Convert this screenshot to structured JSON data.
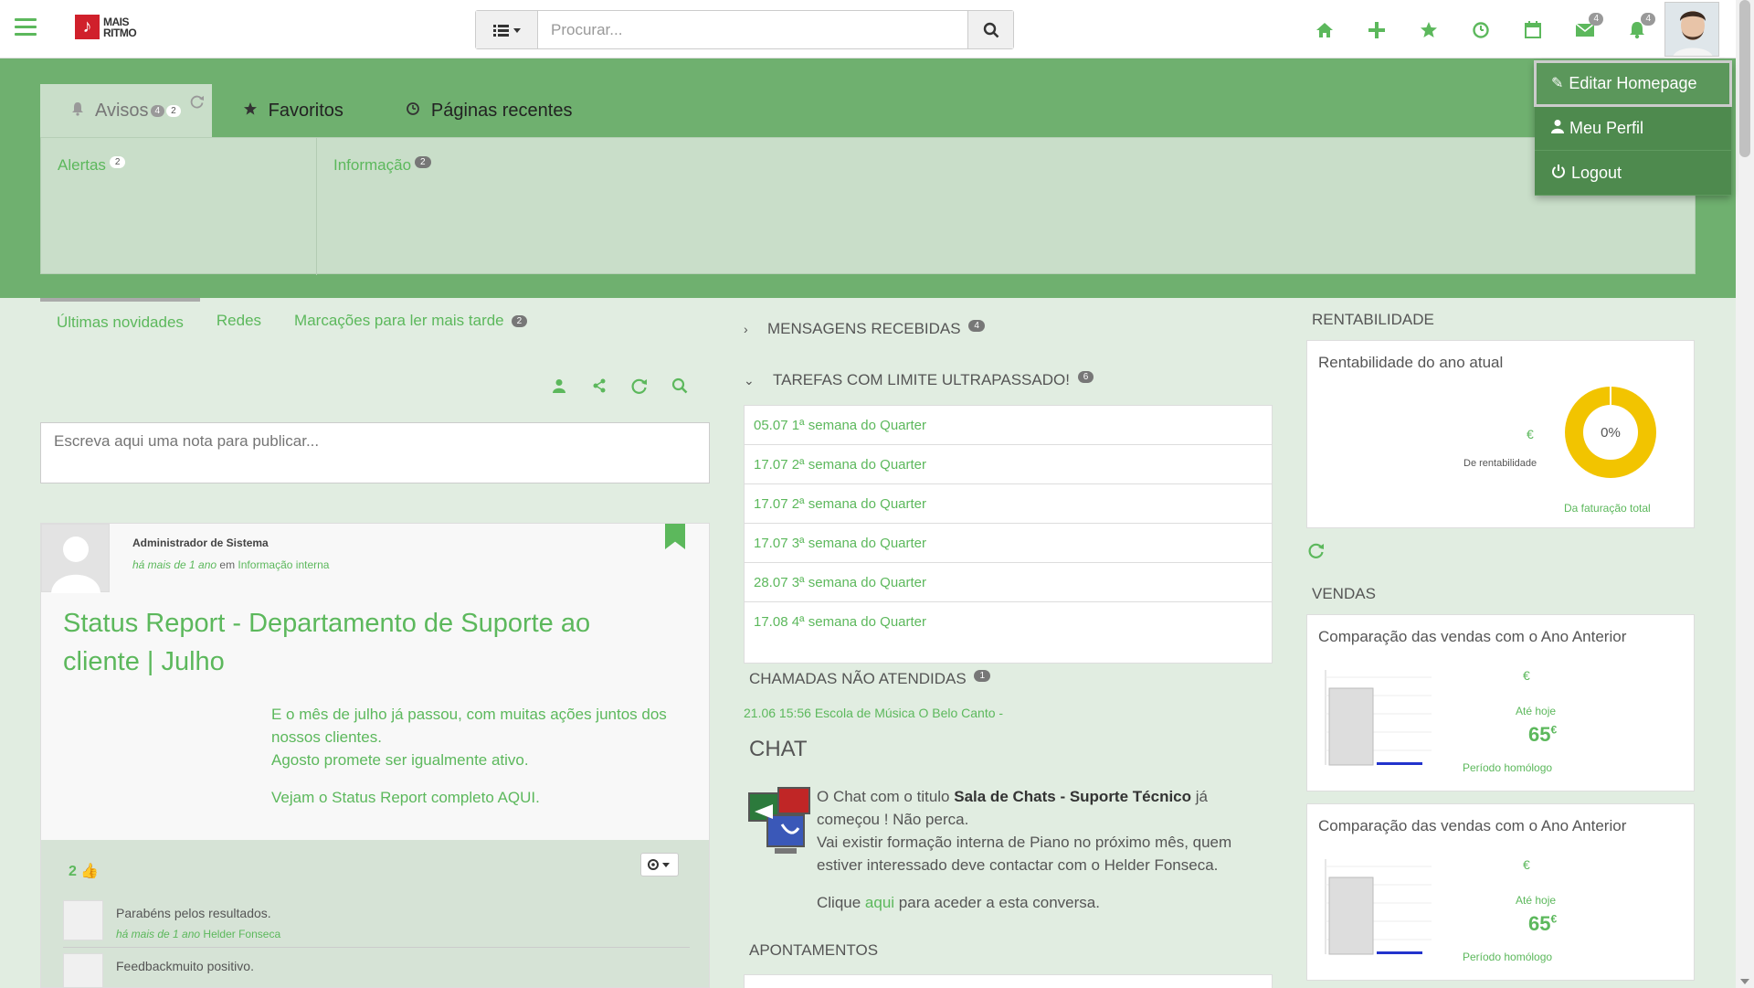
{
  "brand": {
    "logo_line1": "MAIS",
    "logo_line2": "RITMO",
    "logo_glyph": "♪"
  },
  "search": {
    "placeholder": "Procurar..."
  },
  "topnav": {
    "messages_badge": "4",
    "notifications_badge": "4"
  },
  "user_menu": {
    "edit_home": "Editar Homepage",
    "profile": "Meu Perfil",
    "logout": "Logout"
  },
  "header_tabs": {
    "avisos": "Avisos",
    "avisos_badge1": "4",
    "avisos_badge2": "2",
    "favoritos": "Favoritos",
    "recentes": "Páginas recentes"
  },
  "avisos_pane": {
    "alertas": "Alertas",
    "alertas_count": "2",
    "informacao": "Informação",
    "informacao_count": "2"
  },
  "feed_tabs": {
    "novidades": "Últimas novidades",
    "redes": "Redes",
    "marcacoes": "Marcações para ler mais tarde",
    "marcacoes_count": "2"
  },
  "note": {
    "placeholder": "Escreva aqui uma nota para publicar..."
  },
  "post": {
    "author": "Administrador de Sistema",
    "time": "há mais de 1 ano",
    "in_word": "em",
    "category": "Informação interna",
    "title": "Status Report - Departamento de Suporte ao cliente | Julho",
    "body_line1": "E o mês de julho já passou, com muitas ações juntos dos nossos clientes.",
    "body_line2": "Agosto promete ser igualmente ativo.",
    "body_line3": "Vejam o Status Report completo AQUI.",
    "likes": "2"
  },
  "comments": [
    {
      "text": "Parabéns pelos resultados.",
      "time": "há mais de 1 ano",
      "author": "Helder Fonseca"
    },
    {
      "text": "Feedbackmuito positivo."
    }
  ],
  "messages": {
    "title": "MENSAGENS RECEBIDAS",
    "count": "4"
  },
  "tasks": {
    "title": "TAREFAS COM LIMITE ULTRAPASSADO!",
    "count": "6",
    "items": [
      "05.07 1ª semana do Quarter",
      "17.07 2ª semana do Quarter",
      "17.07 2ª semana do Quarter",
      "17.07 3ª semana do Quarter",
      "28.07 3ª semana do Quarter",
      "17.08 4ª semana do Quarter"
    ]
  },
  "calls": {
    "title": "CHAMADAS NÃO ATENDIDAS",
    "count": "1",
    "item": "21.06 15:56 Escola de Música O Belo Canto -"
  },
  "chat": {
    "title": "CHAT",
    "p1_a": "O Chat com o titulo ",
    "p1_b": "Sala de Chats - Suporte Técnico",
    "p1_c": " já começou ! Não perca.",
    "p2": "Vai existir formação interna de Piano no próximo mês, quem estiver interessado deve contactar com o Helder Fonseca.",
    "p3_a": "Clique ",
    "p3_link": "aqui",
    "p3_b": " para aceder a esta conversa."
  },
  "appointments": {
    "title": "APONTAMENTOS"
  },
  "rentabilidade": {
    "title": "RENTABILIDADE",
    "card_title": "Rentabilidade do ano atual",
    "euro": "€",
    "label": "De rentabilidade",
    "percent": "0%",
    "percent_value": 0,
    "foot": "Da faturação total"
  },
  "vendas": {
    "title": "VENDAS",
    "cards": [
      {
        "title": "Comparação das vendas com o Ano Anterior",
        "euro": "€",
        "until": "Até hoje",
        "value": "65",
        "unit": "€",
        "period": "Período homólogo"
      },
      {
        "title": "Comparação das vendas com o Ano Anterior",
        "euro": "€",
        "until": "Até hoje",
        "value": "65",
        "unit": "€",
        "period": "Período homólogo"
      }
    ]
  },
  "colors": {
    "accent": "#5cb85c",
    "hero": "#6fb06f",
    "menu": "#4e8a4e",
    "donut": "#f2c400"
  }
}
